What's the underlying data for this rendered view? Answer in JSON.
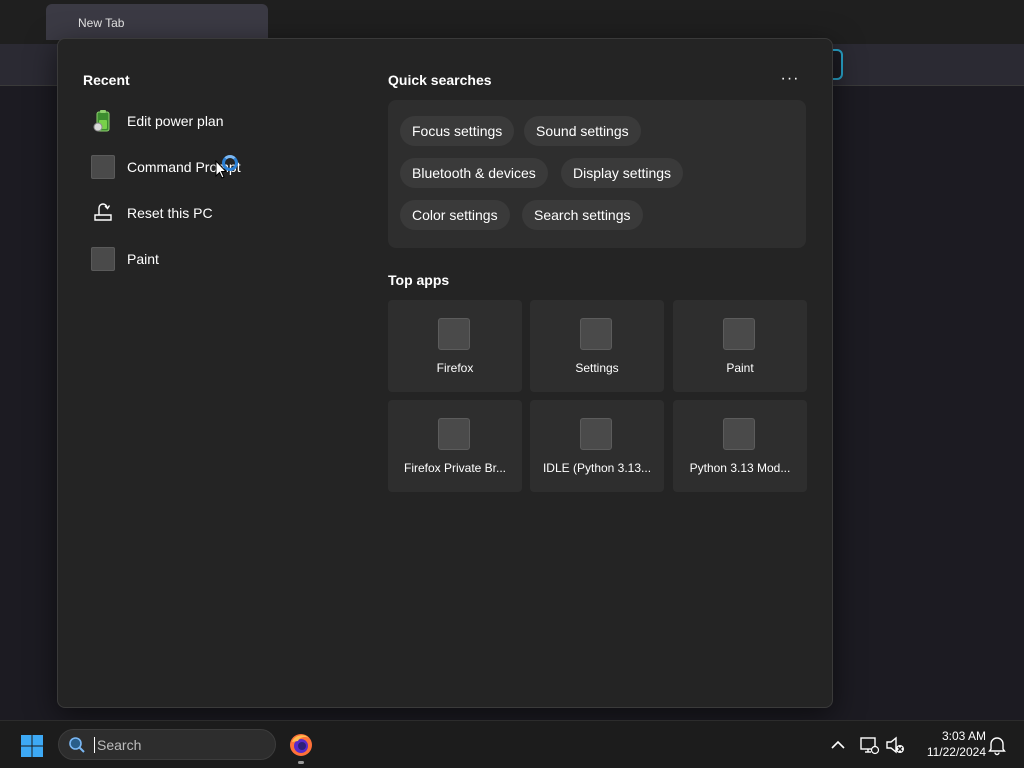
{
  "browser": {
    "tab_title": "New Tab"
  },
  "flyout": {
    "recent": {
      "title": "Recent",
      "items": [
        {
          "label": "Edit power plan",
          "icon": "battery-icon"
        },
        {
          "label": "Command Prompt",
          "icon": "app-placeholder-icon"
        },
        {
          "label": "Reset this PC",
          "icon": "reset-pc-icon"
        },
        {
          "label": "Paint",
          "icon": "app-placeholder-icon"
        }
      ]
    },
    "quick_searches": {
      "title": "Quick searches",
      "more_label": "···",
      "chips": [
        "Focus settings",
        "Sound settings",
        "Bluetooth & devices",
        "Display settings",
        "Color settings",
        "Search settings"
      ]
    },
    "top_apps": {
      "title": "Top apps",
      "apps": [
        "Firefox",
        "Settings",
        "Paint",
        "Firefox Private Br...",
        "IDLE (Python 3.13...",
        "Python 3.13 Mod..."
      ]
    }
  },
  "taskbar": {
    "search_placeholder": "Search",
    "time": "3:03 AM",
    "date": "11/22/2024"
  },
  "colors": {
    "accent": "#28a3c9",
    "flyout_bg": "#242424",
    "chip_bg": "#3a3a3a",
    "tile_bg": "#2e2e2e"
  }
}
